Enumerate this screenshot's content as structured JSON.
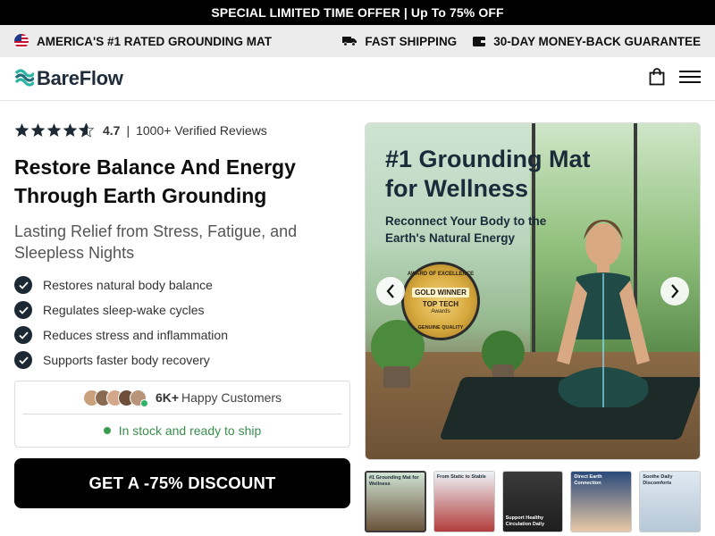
{
  "promo": {
    "text": "SPECIAL LIMITED TIME OFFER | Up To 75% OFF"
  },
  "trust_bar": {
    "left_text": "AMERICA'S #1 RATED GROUNDING MAT",
    "flag_icon": "us-flag-icon",
    "shipping_text": "FAST SHIPPING",
    "shipping_icon": "truck-icon",
    "guarantee_text": "30-DAY MONEY-BACK GUARANTEE",
    "guarantee_icon": "wallet-icon"
  },
  "header": {
    "brand": "BareFlow",
    "brand_color": "#2bb5a3",
    "cart_icon": "shopping-bag-icon",
    "menu_icon": "hamburger-menu-icon"
  },
  "product": {
    "rating_value": "4.7",
    "rating_stars": 4.7,
    "separator": "|",
    "reviews_text": "1000+ Verified Reviews",
    "title": "Restore Balance And Energy Through Earth Grounding",
    "subtitle": "Lasting Relief from Stress, Fatigue, and Sleepless Nights",
    "benefits": [
      "Restores natural body balance",
      "Regulates sleep-wake cycles",
      "Reduces stress and inflammation",
      "Supports faster body recovery"
    ],
    "customers_count": "6K+",
    "customers_label": "Happy Customers",
    "stock_text": "In stock and ready to ship",
    "stock_color": "#3a9a52",
    "cta_label": "GET A -75% DISCOUNT"
  },
  "gallery": {
    "hero_title": "#1 Grounding Mat for Wellness",
    "hero_subtitle": "Reconnect Your Body to the Earth's Natural Energy",
    "badge_top": "AWARD OF EXCELLENCE",
    "badge_main": "GOLD WINNER",
    "badge_sub": "TOP TECH",
    "badge_sub2": "Awards",
    "badge_bottom": "GENUINE QUALITY",
    "prev_icon": "chevron-left-icon",
    "next_icon": "chevron-right-icon",
    "thumbnails": [
      {
        "label": "#1 Grounding Mat for Wellness"
      },
      {
        "label": "From Static to Stable"
      },
      {
        "label": "Support Healthy Circulation Daily"
      },
      {
        "label": "Direct Earth Connection"
      },
      {
        "label": "Soothe Daily Discomforts"
      }
    ]
  }
}
